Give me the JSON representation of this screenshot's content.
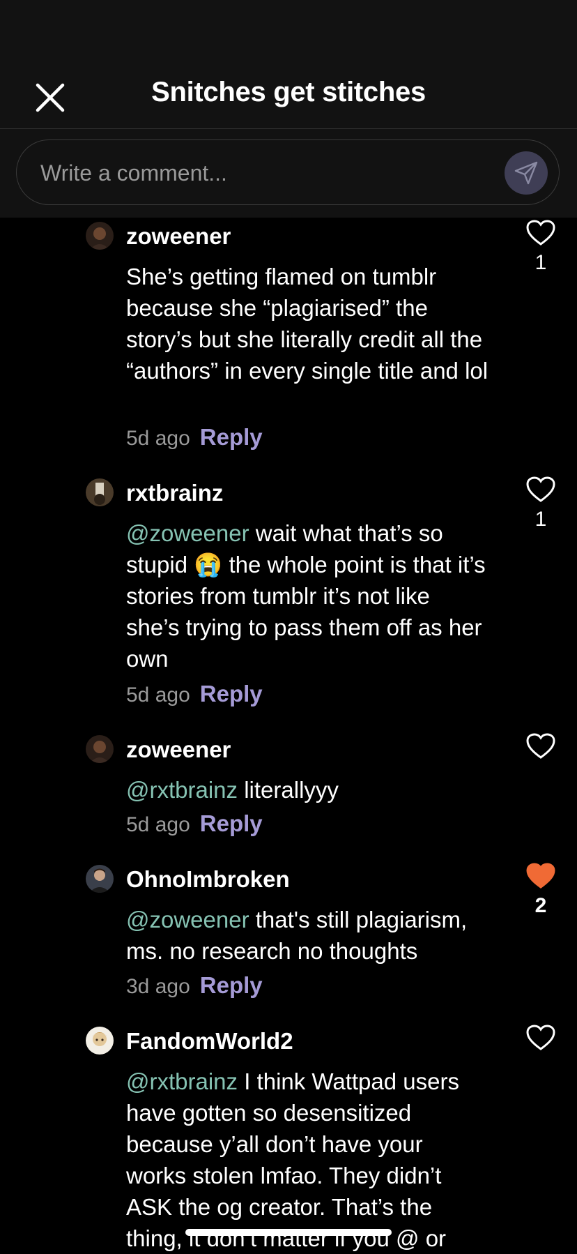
{
  "header": {
    "title": "Snitches get stitches"
  },
  "composer": {
    "placeholder": "Write a comment..."
  },
  "colors": {
    "mention": "#86c3b3",
    "reply": "#a59bd6",
    "liked_heart": "#f06a35",
    "background": "#000000"
  },
  "comments": [
    {
      "username": "zoweener",
      "mention": "",
      "text": "She’s getting flamed on tumblr because she “plagiarised” the story’s but she literally credit all the “authors” in every single title and lol",
      "time": "5d ago",
      "reply": "Reply",
      "likes": "1",
      "liked": false
    },
    {
      "username": "rxtbrainz",
      "mention": "@zoweener",
      "text": " wait what that’s so stupid 😭 the whole point is that it’s stories from tumblr it’s not like she’s trying to pass them off as her own",
      "time": "5d ago",
      "reply": "Reply",
      "likes": "1",
      "liked": false
    },
    {
      "username": "zoweener",
      "mention": "@rxtbrainz",
      "text": " literallyyy",
      "time": "5d ago",
      "reply": "Reply",
      "likes": "",
      "liked": false
    },
    {
      "username": "OhnoImbroken",
      "mention": "@zoweener",
      "text": " that's still plagiarism, ms. no research no thoughts",
      "time": "3d ago",
      "reply": "Reply",
      "likes": "2",
      "liked": true
    },
    {
      "username": "FandomWorld2",
      "mention": "@rxtbrainz",
      "text": " I think Wattpad users have gotten so desensitized because y’all don’t have your works stolen lmfao. They didn’t ASK the og creator. That’s the thing, it don’t matter if you @ or",
      "time": "",
      "reply": "",
      "likes": "",
      "liked": false
    }
  ]
}
